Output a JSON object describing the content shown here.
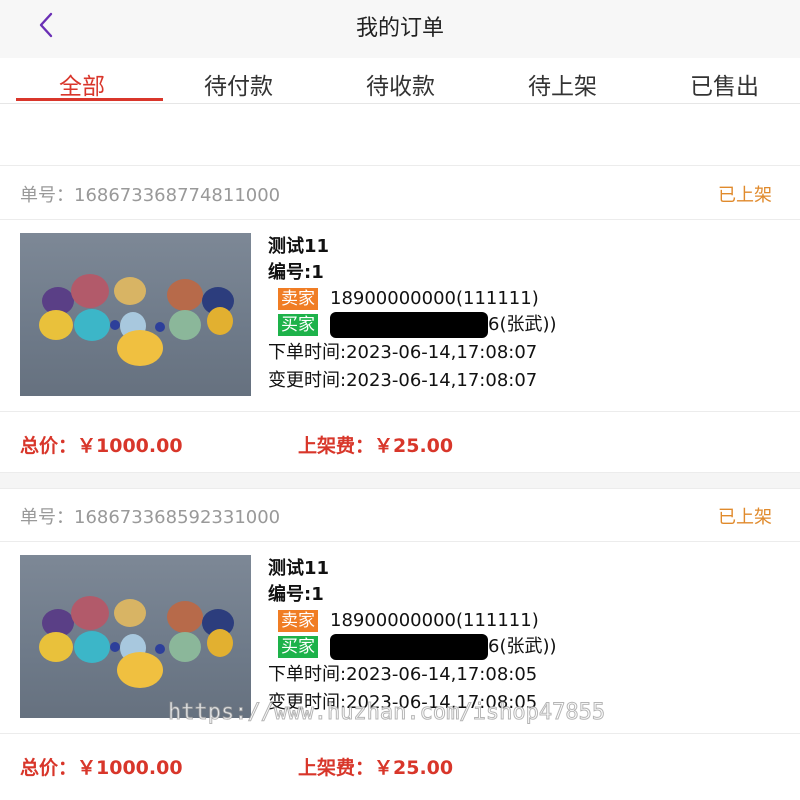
{
  "header": {
    "title": "我的订单",
    "back_icon": "chevron-left-icon",
    "back_color": "#6a2fb5"
  },
  "tabs": [
    {
      "label": "全部",
      "active": true
    },
    {
      "label": "待付款",
      "active": false
    },
    {
      "label": "待收款",
      "active": false
    },
    {
      "label": "待上架",
      "active": false
    },
    {
      "label": "已售出",
      "active": false
    }
  ],
  "colors": {
    "accent_red": "#d9362b",
    "status_orange": "#e08a2c",
    "seller_badge": "#f07d24",
    "buyer_badge": "#1db24a"
  },
  "orders": [
    {
      "order_label": "单号：",
      "order_no": "168673368774811000",
      "status": "已上架",
      "name": "测试11",
      "code": "编号:1",
      "seller_badge": "卖家",
      "seller_info": "18900000000(111111)",
      "buyer_badge": "买家",
      "buyer_info_tail": "6(张武))",
      "created": "下单时间:2023-06-14,17:08:07",
      "changed": "变更时间:2023-06-14,17:08:07",
      "total": "总价：￥1000.00",
      "fee": "上架费：￥25.00"
    },
    {
      "order_label": "单号：",
      "order_no": "168673368592331000",
      "status": "已上架",
      "name": "测试11",
      "code": "编号:1",
      "seller_badge": "卖家",
      "seller_info": "18900000000(111111)",
      "buyer_badge": "买家",
      "buyer_info_tail": "6(张武))",
      "created": "下单时间:2023-06-14,17:08:05",
      "changed": "变更时间:2023-06-14,17:08:05",
      "total": "总价：￥1000.00",
      "fee": "上架费：￥25.00"
    }
  ],
  "watermark": "https://www.huzhan.com/ishop47855"
}
